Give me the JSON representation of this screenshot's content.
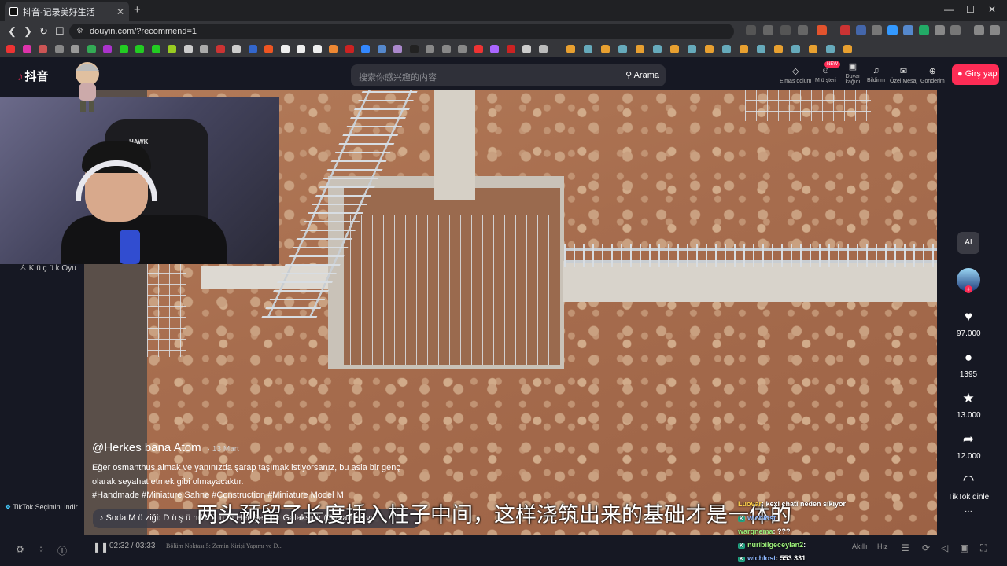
{
  "browser": {
    "tab_title": "抖音-记录美好生活",
    "tab_close": "✕",
    "new_tab": "+",
    "url": "douyin.com/?recommend=1",
    "nav": {
      "back": "❮",
      "forward": "❯",
      "reload": "↻",
      "bookmark": "☐"
    },
    "window_controls": {
      "minimize": "—",
      "maximize": "☐",
      "close": "✕"
    }
  },
  "header": {
    "logo_text": "抖音",
    "search_placeholder": "搜索你感兴趣的内容",
    "search_button": "Arama",
    "nav_items": [
      {
        "label": "Elmas dolum",
        "icon": "◇"
      },
      {
        "label": "M ü şteri",
        "icon": "☺"
      },
      {
        "label": "Duvar kağıdı",
        "icon": "▣"
      },
      {
        "label": "Bildirim",
        "icon": "♫"
      },
      {
        "label": "Özel Mesaj",
        "icon": "✉"
      },
      {
        "label": "Gönderim",
        "icon": "⊕"
      }
    ],
    "new_badge": "NEW",
    "login_button": "Girş yap"
  },
  "sidebar": {
    "item_label": "K ü ç ü k Oyu",
    "tiktok_selection": "TikTok Seçimini İndir"
  },
  "webcam": {
    "chair_brand": "HAWK"
  },
  "video": {
    "author": "@Herkes bana Atom",
    "date": "· 13 Mart",
    "description": "Eğer osmanthus almak ve yanınızda şarap taşımak istiyorsanız, bu asla bir genç olarak seyahat etmek gibi olmayacaktır.",
    "tags": "#Handmade  #Miniature  Sahne  #Construction  #Miniature  Model  M",
    "music": "♪ Soda M ü ziği: D ü ş ü nd ü ğ ü m Her Şey Bir Galaksidir (Oynamak ve",
    "subtitle": "两头预留了长度插入柱子中间，这样浇筑出来的基础才是一体的"
  },
  "rail": {
    "ai_label": "AI",
    "likes": "97.000",
    "comments": "1395",
    "favorites": "13.000",
    "shares": "12.000",
    "listen_label": "TikTok dinle",
    "more": "···"
  },
  "player": {
    "pause_icon": "❚❚",
    "time": "02:32 / 03:33",
    "chapter": "Bölüm Noktası 5: Zemin Kirişi Yapımı ve D...",
    "auto_label": "Akıllı",
    "speed_label": "Hız"
  },
  "chat": [
    {
      "user": "Luovar",
      "text": ": kexi chatı neden sıkıyor"
    },
    {
      "user": "wichlost",
      "text": ""
    },
    {
      "user": "wargnema",
      "text": ": ???"
    },
    {
      "user": "nuribilgeceylan2",
      "text": ":"
    },
    {
      "user": "wichlost",
      "text": ": 553 331"
    }
  ],
  "colors": {
    "accent": "#fe2c55",
    "page_bg": "#161823"
  }
}
